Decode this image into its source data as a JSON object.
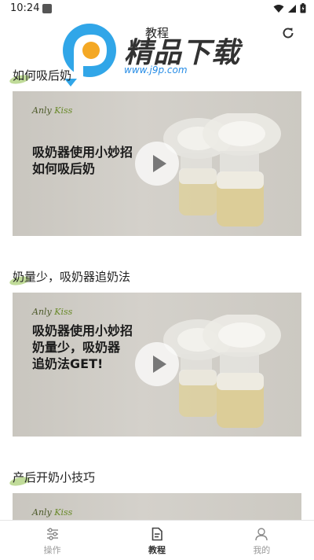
{
  "status_bar": {
    "time": "10:24"
  },
  "header": {
    "title": "教程"
  },
  "watermark": {
    "text": "精品下载",
    "url": "www.j9p.com"
  },
  "tutorials": [
    {
      "title": "如何吸后奶",
      "brand_a": "Anly",
      "brand_b": "Kiss",
      "caption": [
        "吸奶器使用小妙招",
        "如何吸后奶"
      ]
    },
    {
      "title": "奶量少，吸奶器追奶法",
      "brand_a": "Anly",
      "brand_b": "Kiss",
      "caption": [
        "吸奶器使用小妙招",
        "奶量少，吸奶器",
        "追奶法GET!"
      ]
    },
    {
      "title": "产后开奶小技巧",
      "brand_a": "Anly",
      "brand_b": "Kiss"
    }
  ],
  "bottle_label": "Anly Kiss",
  "nav": [
    {
      "label": "操作",
      "icon": "sliders-icon",
      "active": false
    },
    {
      "label": "教程",
      "icon": "document-icon",
      "active": true
    },
    {
      "label": "我的",
      "icon": "user-icon",
      "active": false
    }
  ],
  "colors": {
    "accent_leaf": "#8cbe46",
    "watermark_blue": "#1e88e5"
  }
}
